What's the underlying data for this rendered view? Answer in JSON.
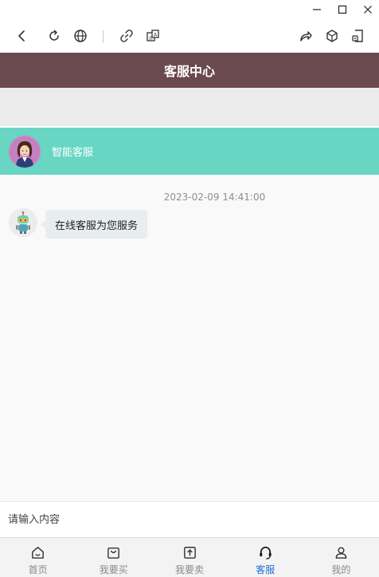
{
  "window": {
    "controls": [
      "minimize-icon",
      "maximize-icon",
      "close-icon"
    ]
  },
  "browser_toolbar": {
    "left_icons": [
      "back-icon",
      "reload-icon",
      "globe-icon",
      "link-icon",
      "translate-icon"
    ],
    "right_icons": [
      "share-icon",
      "cube-icon",
      "extension-icon"
    ]
  },
  "header": {
    "title": "客服中心",
    "color": "#6a4a4f"
  },
  "agent": {
    "name": "智能客服",
    "bar_color": "#69d6c4"
  },
  "chat": {
    "timestamp": "2023-02-09 14:41:00",
    "messages": [
      {
        "sender": "bot",
        "text": "在线客服为您服务"
      }
    ]
  },
  "input": {
    "placeholder": "请输入内容",
    "value": ""
  },
  "nav": {
    "items": [
      {
        "label": "首页",
        "icon": "home-icon"
      },
      {
        "label": "我要买",
        "icon": "shopping-bag-icon"
      },
      {
        "label": "我要卖",
        "icon": "upload-icon"
      },
      {
        "label": "客服",
        "icon": "headset-icon",
        "active": true
      },
      {
        "label": "我的",
        "icon": "user-icon"
      }
    ],
    "active_color": "#1e6fd0"
  }
}
